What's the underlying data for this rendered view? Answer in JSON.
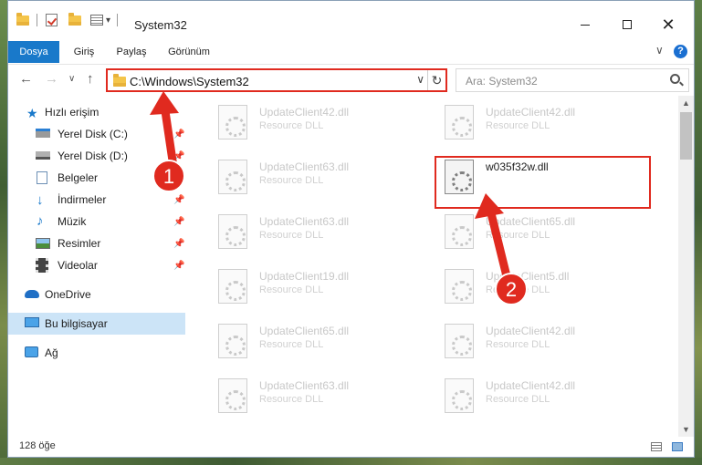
{
  "titlebar": {
    "title": "System32",
    "qa_dropdown": "▾",
    "minimize_label": "",
    "maximize_label": "",
    "close_label": "✕"
  },
  "ribbon": {
    "tabs": [
      "Dosya",
      "Giriş",
      "Paylaş",
      "Görünüm"
    ],
    "collapse_chevron": "∨",
    "help": "?"
  },
  "address": {
    "back": "←",
    "forward": "→",
    "recent": "∨",
    "up": "↑",
    "path": "C:\\Windows\\System32",
    "dropdown": "∨",
    "refresh": "↻"
  },
  "search": {
    "placeholder": "Ara: System32"
  },
  "sidebar": {
    "items": [
      {
        "label": "Hızlı erişim",
        "icon": "star-icon"
      },
      {
        "label": "Yerel Disk (C:)",
        "icon": "drive-icon",
        "pinned": true
      },
      {
        "label": "Yerel Disk (D:)",
        "icon": "drive-icon",
        "pinned": true
      },
      {
        "label": "Belgeler",
        "icon": "documents-icon",
        "pinned": true
      },
      {
        "label": "İndirmeler",
        "icon": "download-icon",
        "pinned": true
      },
      {
        "label": "Müzik",
        "icon": "music-icon",
        "pinned": true
      },
      {
        "label": "Resimler",
        "icon": "pictures-icon",
        "pinned": true
      },
      {
        "label": "Videolar",
        "icon": "video-icon",
        "pinned": true
      },
      {
        "label": "OneDrive",
        "icon": "cloud-icon"
      },
      {
        "label": "Bu bilgisayar",
        "icon": "computer-icon",
        "selected": true
      },
      {
        "label": "Ağ",
        "icon": "network-icon"
      }
    ],
    "pin_glyph": "📌"
  },
  "files": [
    {
      "name": "UpdateClient42.dll",
      "type": "Resource DLL"
    },
    {
      "name": "UpdateClient42.dll",
      "type": "Resource DLL"
    },
    {
      "name": "UpdateClient63.dll",
      "type": "Resource DLL"
    },
    {
      "name": "w035f32w.dll",
      "type": "Resource DLL",
      "highlighted": true
    },
    {
      "name": "UpdateClient63.dll",
      "type": "Resource DLL"
    },
    {
      "name": "UpdateClient65.dll",
      "type": "Resource DLL"
    },
    {
      "name": "UpdateClient19.dll",
      "type": "Resource DLL"
    },
    {
      "name": "UpdateClient5.dll",
      "type": "Resource DLL"
    },
    {
      "name": "UpdateClient65.dll",
      "type": "Resource DLL"
    },
    {
      "name": "UpdateClient42.dll",
      "type": "Resource DLL"
    },
    {
      "name": "UpdateClient63.dll",
      "type": "Resource DLL"
    },
    {
      "name": "UpdateClient42.dll",
      "type": "Resource DLL"
    }
  ],
  "annotations": {
    "step1": "1",
    "step2": "2",
    "color": "#e02a1f"
  },
  "statusbar": {
    "item_count": "128 öğe"
  },
  "scrollbar": {
    "up": "▲",
    "down": "▼"
  }
}
